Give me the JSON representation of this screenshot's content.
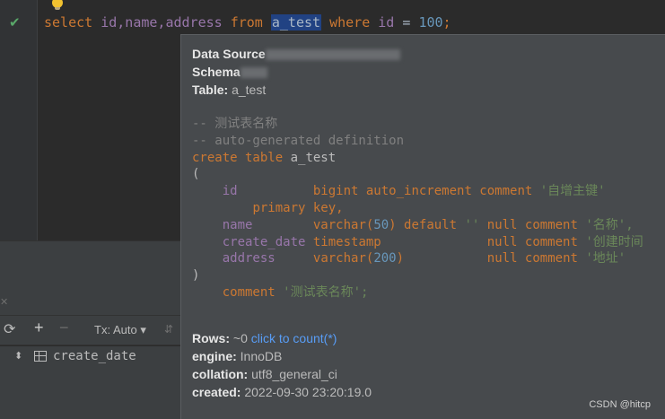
{
  "editor": {
    "query": {
      "select": "select",
      "columns": "id,name,address",
      "from": "from",
      "table": "a_test",
      "where": "where",
      "field": "id",
      "op": "=",
      "value": "100",
      "end": ";"
    },
    "gutter_status_icon": "check-icon",
    "hint_icon": "lightbulb-icon"
  },
  "tool_panel": {
    "tx_label": "Tx: Auto",
    "tree_item": "create_date"
  },
  "popup": {
    "data_source_label": "Data Source",
    "schema_label": "Schema",
    "table_label": "Table:",
    "table_value": "a_test",
    "comment_line": "-- 测试表名称",
    "autogen_line": "-- auto-generated definition",
    "create_kw": "create table",
    "create_table": "a_test",
    "open_paren": "(",
    "close_paren": ")",
    "columns": [
      {
        "name": "id",
        "type": "bigint auto_increment comment",
        "comment": "'自增主键'",
        "extra": "primary key,"
      },
      {
        "name": "name",
        "type_kw": "varchar(",
        "type_num": "50",
        "type_end": ") default",
        "default": "''",
        "null": "null comment",
        "comment": "'名称',"
      },
      {
        "name": "create_date",
        "type": "timestamp",
        "null": "null comment",
        "comment": "'创建时间"
      },
      {
        "name": "address",
        "type_kw": "varchar(",
        "type_num": "200",
        "type_end": ")",
        "null": "null comment",
        "comment": "'地址'"
      }
    ],
    "table_comment_kw": "comment",
    "table_comment": "'测试表名称';",
    "rows_label": "Rows:",
    "rows_value": "~0",
    "rows_link": "click to count(*)",
    "engine_label": "engine:",
    "engine_value": "InnoDB",
    "collation_label": "collation:",
    "collation_value": "utf8_general_ci",
    "created_label": "created:",
    "created_value": "2022-09-30 23:20:19.0"
  },
  "watermark": "CSDN @hitcp"
}
